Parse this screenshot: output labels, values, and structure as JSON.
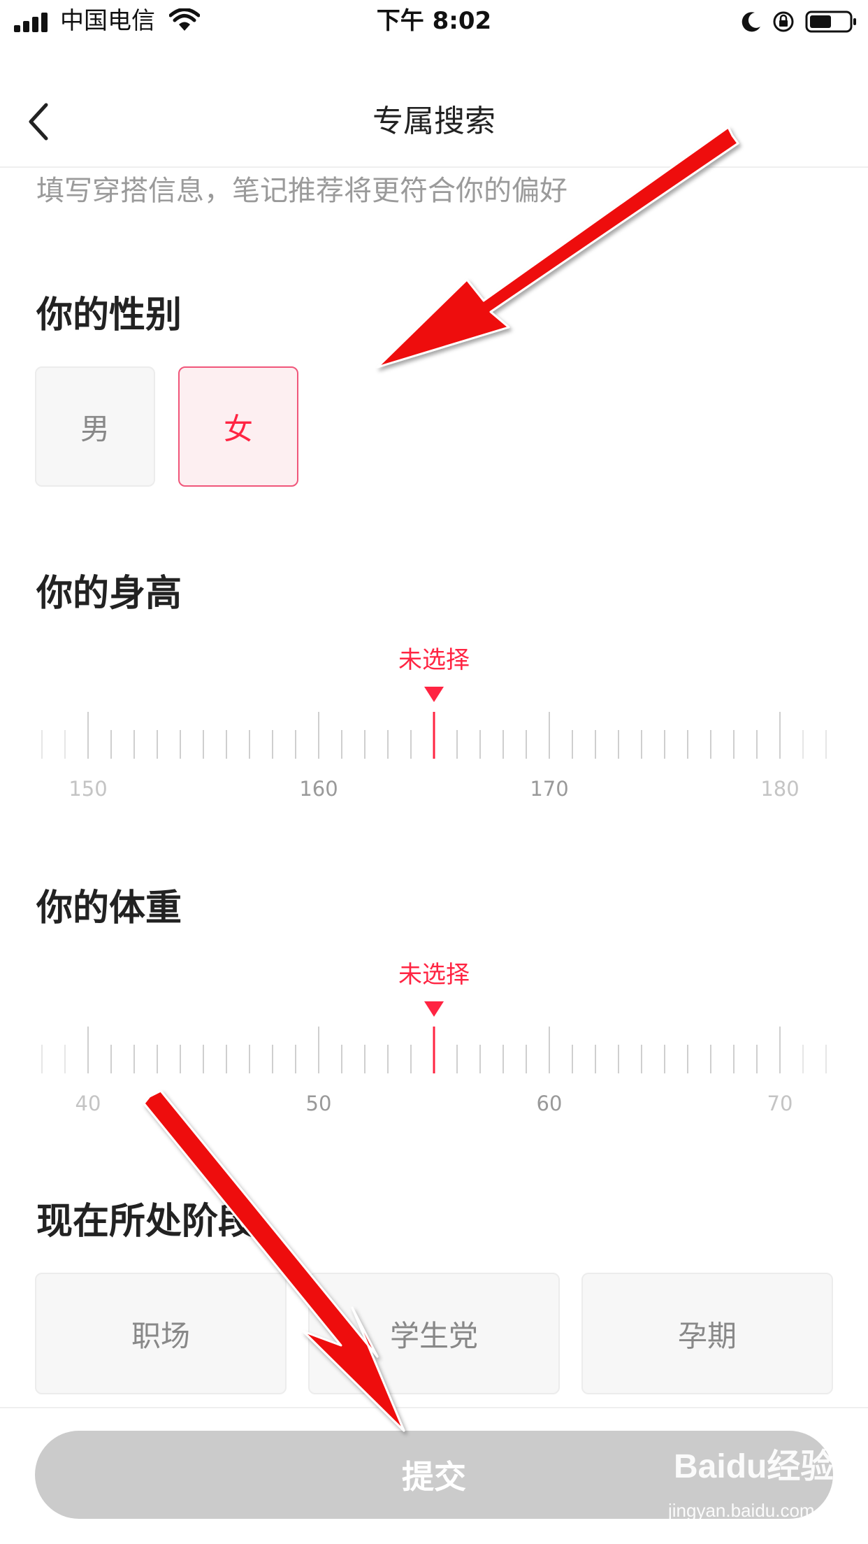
{
  "status_bar": {
    "carrier": "中国电信",
    "time": "下午 8:02"
  },
  "nav": {
    "title": "专属搜索"
  },
  "subtitle": "填写穿搭信息，笔记推荐将更符合你的偏好",
  "gender": {
    "heading": "你的性别",
    "options": [
      {
        "label": "男",
        "selected": false
      },
      {
        "label": "女",
        "selected": true
      }
    ]
  },
  "height": {
    "heading": "你的身高",
    "selection": "未选择",
    "tick_labels": [
      "150",
      "160",
      "170",
      "180"
    ]
  },
  "weight": {
    "heading": "你的体重",
    "selection": "未选择",
    "tick_labels": [
      "40",
      "50",
      "60",
      "70"
    ]
  },
  "stage": {
    "heading": "现在所处阶段",
    "options": [
      {
        "label": "职场"
      },
      {
        "label": "学生党"
      },
      {
        "label": "孕期"
      }
    ]
  },
  "submit": {
    "label": "提交"
  },
  "watermark": {
    "brand": "Baidu经验",
    "url": "jingyan.baidu.com"
  },
  "colors": {
    "accent": "#ff2442",
    "selected_bg": "#fdeff1",
    "submit_bg": "#cbcbcb",
    "annotation_arrow": "#ee1111"
  },
  "icons": {
    "back": "chevron-left-icon",
    "signal": "signal-icon",
    "wifi": "wifi-icon",
    "moon": "moon-icon",
    "rotation_lock": "rotation-lock-icon",
    "battery": "battery-icon"
  }
}
